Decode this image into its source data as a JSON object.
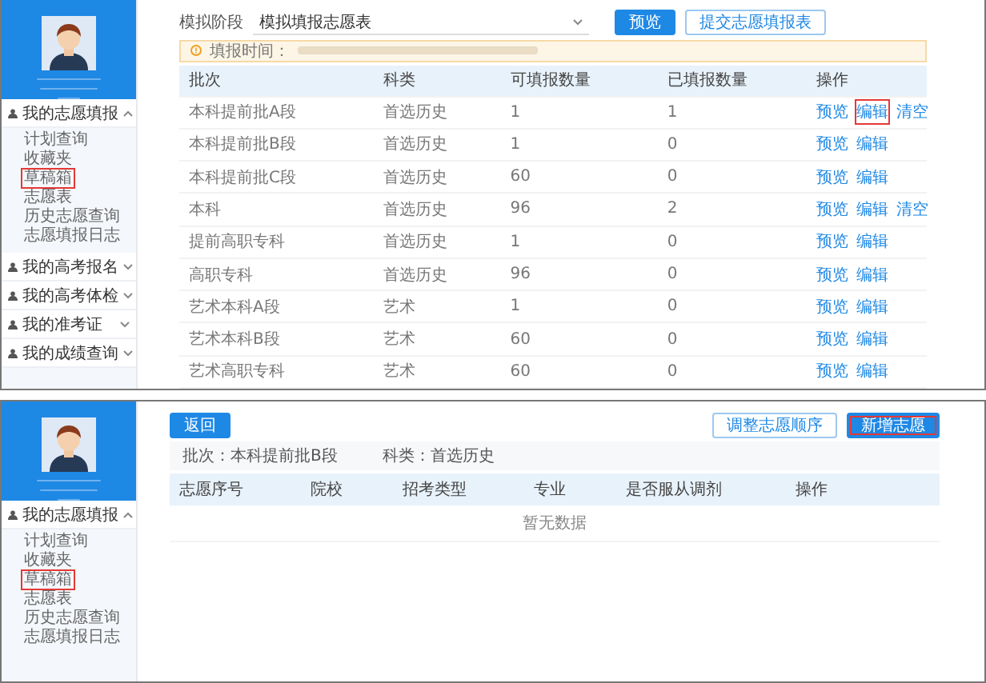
{
  "top_screen": {
    "sidebar": {
      "groups": [
        {
          "label": "我的志愿填报",
          "expanded": true,
          "items": [
            {
              "label": "计划查询",
              "highlighted": false
            },
            {
              "label": "收藏夹",
              "highlighted": false
            },
            {
              "label": "草稿箱",
              "highlighted": true
            },
            {
              "label": "志愿表",
              "highlighted": false
            },
            {
              "label": "历史志愿查询",
              "highlighted": false
            },
            {
              "label": "志愿填报日志",
              "highlighted": false
            }
          ]
        },
        {
          "label": "我的高考报名",
          "expanded": false
        },
        {
          "label": "我的高考体检",
          "expanded": false
        },
        {
          "label": "我的准考证",
          "expanded": false
        },
        {
          "label": "我的成绩查询",
          "expanded": false
        }
      ]
    },
    "stage_label": "模拟阶段",
    "stage_select": "模拟填报志愿表",
    "buttons": [
      {
        "label": "预览",
        "kind": "primary",
        "highlighted": false
      },
      {
        "label": "提交志愿填报表",
        "kind": "outline",
        "highlighted": false
      }
    ],
    "notice": "填报时间：",
    "table": {
      "columns": [
        "批次",
        "科类",
        "可填报数量",
        "已填报数量",
        "操作"
      ],
      "rows": [
        {
          "cells": [
            "本科提前批A段",
            "首选历史",
            "1",
            "1"
          ],
          "actions": [
            {
              "label": "预览",
              "highlighted": false
            },
            {
              "label": "编辑",
              "highlighted": true
            },
            {
              "label": "清空",
              "highlighted": false
            }
          ]
        },
        {
          "cells": [
            "本科提前批B段",
            "首选历史",
            "1",
            "0"
          ],
          "actions": [
            {
              "label": "预览",
              "highlighted": false
            },
            {
              "label": "编辑",
              "highlighted": false
            }
          ]
        },
        {
          "cells": [
            "本科提前批C段",
            "首选历史",
            "60",
            "0"
          ],
          "actions": [
            {
              "label": "预览",
              "highlighted": false
            },
            {
              "label": "编辑",
              "highlighted": false
            }
          ]
        },
        {
          "cells": [
            "本科",
            "首选历史",
            "96",
            "2"
          ],
          "actions": [
            {
              "label": "预览",
              "highlighted": false
            },
            {
              "label": "编辑",
              "highlighted": false
            },
            {
              "label": "清空",
              "highlighted": false
            }
          ]
        },
        {
          "cells": [
            "提前高职专科",
            "首选历史",
            "1",
            "0"
          ],
          "actions": [
            {
              "label": "预览",
              "highlighted": false
            },
            {
              "label": "编辑",
              "highlighted": false
            }
          ]
        },
        {
          "cells": [
            "高职专科",
            "首选历史",
            "96",
            "0"
          ],
          "actions": [
            {
              "label": "预览",
              "highlighted": false
            },
            {
              "label": "编辑",
              "highlighted": false
            }
          ]
        },
        {
          "cells": [
            "艺术本科A段",
            "艺术",
            "1",
            "0"
          ],
          "actions": [
            {
              "label": "预览",
              "highlighted": false
            },
            {
              "label": "编辑",
              "highlighted": false
            }
          ]
        },
        {
          "cells": [
            "艺术本科B段",
            "艺术",
            "60",
            "0"
          ],
          "actions": [
            {
              "label": "预览",
              "highlighted": false
            },
            {
              "label": "编辑",
              "highlighted": false
            }
          ]
        },
        {
          "cells": [
            "艺术高职专科",
            "艺术",
            "60",
            "0"
          ],
          "actions": [
            {
              "label": "预览",
              "highlighted": false
            },
            {
              "label": "编辑",
              "highlighted": false
            }
          ]
        }
      ]
    }
  },
  "bottom_screen": {
    "sidebar": {
      "groups": [
        {
          "label": "我的志愿填报",
          "expanded": true,
          "items": [
            {
              "label": "计划查询",
              "highlighted": false
            },
            {
              "label": "收藏夹",
              "highlighted": false
            },
            {
              "label": "草稿箱",
              "highlighted": true
            },
            {
              "label": "志愿表",
              "highlighted": false
            },
            {
              "label": "历史志愿查询",
              "highlighted": false
            },
            {
              "label": "志愿填报日志",
              "highlighted": false
            }
          ]
        }
      ]
    },
    "back_button": "返回",
    "buttons": [
      {
        "label": "调整志愿顺序",
        "kind": "outline",
        "highlighted": false
      },
      {
        "label": "新增志愿",
        "kind": "primary",
        "highlighted": true
      }
    ],
    "info": [
      "批次：本科提前批B段",
      "科类：首选历史"
    ],
    "table": {
      "columns": [
        "志愿序号",
        "院校",
        "招考类型",
        "专业",
        "是否服从调剂",
        "操作"
      ],
      "empty_text": "暂无数据"
    }
  }
}
